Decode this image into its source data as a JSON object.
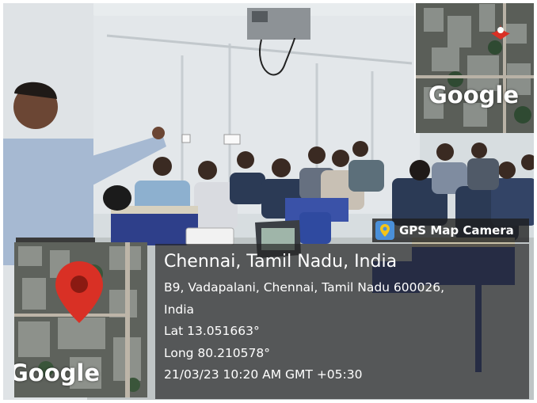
{
  "watermark": {
    "app_name": "GPS Map Camera"
  },
  "location": {
    "title": "Chennai, Tamil Nadu, India",
    "address_line1": "B9, Vadapalani, Chennai, Tamil Nadu 600026,",
    "address_line2": "India",
    "lat": "Lat 13.051663°",
    "long": "Long 80.210578°",
    "datetime": "21/03/23 10:20 AM GMT +05:30"
  },
  "maps": {
    "top_label": "Google",
    "bottom_label": "Google"
  },
  "colors": {
    "pin": "#d93025",
    "overlay": "#232323",
    "badge_icon": "#4a90d9"
  }
}
